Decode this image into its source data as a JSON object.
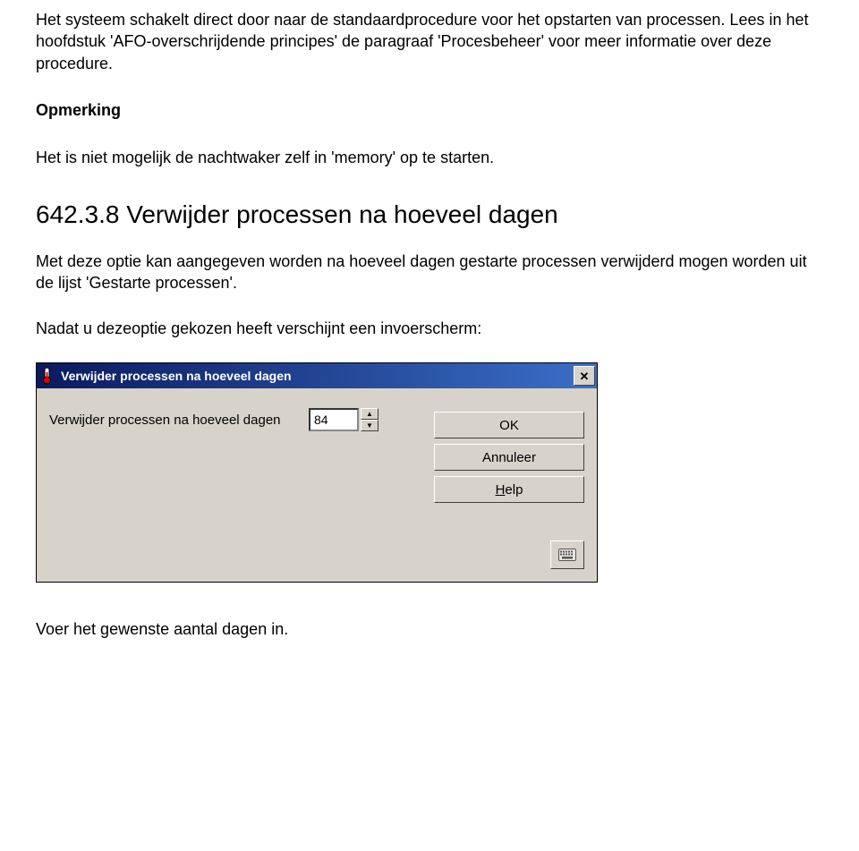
{
  "para1": "Het systeem schakelt direct door naar de standaardprocedure voor het opstarten van processen. Lees in het hoofdstuk 'AFO-overschrijdende principes' de paragraaf 'Procesbeheer' voor meer informatie over deze procedure.",
  "note_heading": "Opmerking",
  "note_text": "Het is niet mogelijk de nachtwaker zelf in 'memory' op te starten.",
  "section_heading": "642.3.8 Verwijder processen na hoeveel dagen",
  "para2": "Met deze optie kan aangegeven worden na hoeveel dagen gestarte processen verwijderd mogen worden uit de lijst 'Gestarte processen'.",
  "para3": "Nadat u dezeoptie gekozen heeft verschijnt een invoerscherm:",
  "para4": "Voer het gewenste aantal dagen in.",
  "dialog": {
    "title": "Verwijder processen na hoeveel dagen",
    "label": "Verwijder processen na hoeveel dagen",
    "value": "84",
    "ok": "OK",
    "cancel": "Annuleer",
    "help_prefix": "H",
    "help_rest": "elp"
  }
}
